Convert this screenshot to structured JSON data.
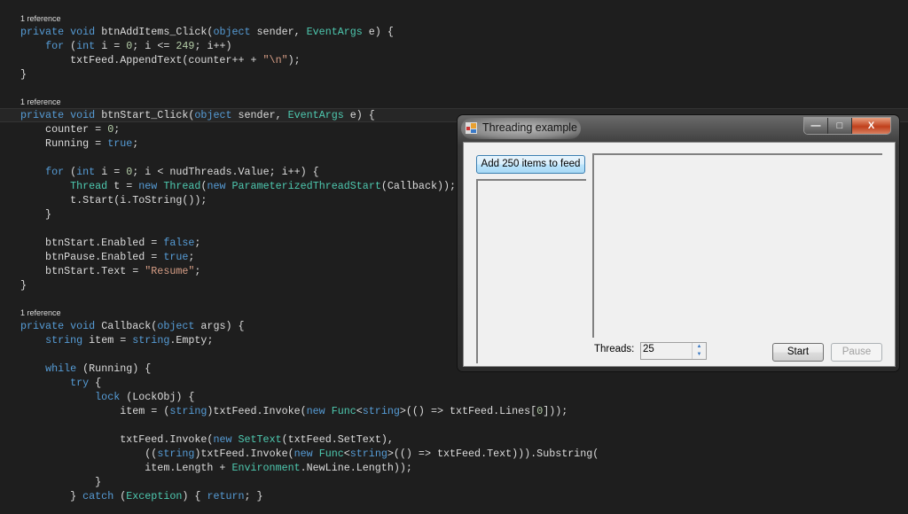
{
  "editor": {
    "lines": [
      {
        "kind": "ref",
        "tokens": [
          [
            "pl",
            "1 reference"
          ]
        ]
      },
      {
        "kind": "code",
        "tokens": [
          [
            "kw",
            "private void "
          ],
          [
            "pl",
            "btnAddItems_Click("
          ],
          [
            "kw",
            "object"
          ],
          [
            "pl",
            " sender, "
          ],
          [
            "ty",
            "EventArgs"
          ],
          [
            "pl",
            " e) {"
          ]
        ]
      },
      {
        "kind": "code",
        "tokens": [
          [
            "pl",
            "    "
          ],
          [
            "kw",
            "for"
          ],
          [
            "pl",
            " ("
          ],
          [
            "kw",
            "int"
          ],
          [
            "pl",
            " i = "
          ],
          [
            "nu",
            "0"
          ],
          [
            "pl",
            "; i <= "
          ],
          [
            "nu",
            "249"
          ],
          [
            "pl",
            "; i++)"
          ]
        ]
      },
      {
        "kind": "code",
        "tokens": [
          [
            "pl",
            "        txtFeed.AppendText(counter++ + "
          ],
          [
            "st",
            "\"\\n\""
          ],
          [
            "pl",
            ");"
          ]
        ]
      },
      {
        "kind": "code",
        "tokens": [
          [
            "pl",
            "}"
          ]
        ]
      },
      {
        "kind": "code",
        "tokens": []
      },
      {
        "kind": "ref",
        "tokens": [
          [
            "pl",
            "1 reference"
          ]
        ]
      },
      {
        "kind": "cur",
        "tokens": [
          [
            "kw",
            "private void "
          ],
          [
            "pl",
            "btnStart_Click("
          ],
          [
            "kw",
            "object"
          ],
          [
            "pl",
            " sender, "
          ],
          [
            "ty",
            "EventArgs"
          ],
          [
            "pl",
            " e) {"
          ]
        ]
      },
      {
        "kind": "code",
        "tokens": [
          [
            "pl",
            "    counter = "
          ],
          [
            "nu",
            "0"
          ],
          [
            "pl",
            ";"
          ]
        ]
      },
      {
        "kind": "code",
        "tokens": [
          [
            "pl",
            "    Running = "
          ],
          [
            "kw",
            "true"
          ],
          [
            "pl",
            ";"
          ]
        ]
      },
      {
        "kind": "code",
        "tokens": []
      },
      {
        "kind": "code",
        "tokens": [
          [
            "pl",
            "    "
          ],
          [
            "kw",
            "for"
          ],
          [
            "pl",
            " ("
          ],
          [
            "kw",
            "int"
          ],
          [
            "pl",
            " i = "
          ],
          [
            "nu",
            "0"
          ],
          [
            "pl",
            "; i < nudThreads.Value; i++) {"
          ]
        ]
      },
      {
        "kind": "code",
        "tokens": [
          [
            "pl",
            "        "
          ],
          [
            "ty",
            "Thread"
          ],
          [
            "pl",
            " t = "
          ],
          [
            "kw",
            "new "
          ],
          [
            "ty",
            "Thread"
          ],
          [
            "pl",
            "("
          ],
          [
            "kw",
            "new "
          ],
          [
            "ty",
            "ParameterizedThreadStart"
          ],
          [
            "pl",
            "(Callback));"
          ]
        ]
      },
      {
        "kind": "code",
        "tokens": [
          [
            "pl",
            "        t.Start(i.ToString());"
          ]
        ]
      },
      {
        "kind": "code",
        "tokens": [
          [
            "pl",
            "    }"
          ]
        ]
      },
      {
        "kind": "code",
        "tokens": []
      },
      {
        "kind": "code",
        "tokens": [
          [
            "pl",
            "    btnStart.Enabled = "
          ],
          [
            "kw",
            "false"
          ],
          [
            "pl",
            ";"
          ]
        ]
      },
      {
        "kind": "code",
        "tokens": [
          [
            "pl",
            "    btnPause.Enabled = "
          ],
          [
            "kw",
            "true"
          ],
          [
            "pl",
            ";"
          ]
        ]
      },
      {
        "kind": "code",
        "tokens": [
          [
            "pl",
            "    btnStart.Text = "
          ],
          [
            "st",
            "\"Resume\""
          ],
          [
            "pl",
            ";"
          ]
        ]
      },
      {
        "kind": "code",
        "tokens": [
          [
            "pl",
            "}"
          ]
        ]
      },
      {
        "kind": "code",
        "tokens": []
      },
      {
        "kind": "ref",
        "tokens": [
          [
            "pl",
            "1 reference"
          ]
        ]
      },
      {
        "kind": "code",
        "tokens": [
          [
            "kw",
            "private void "
          ],
          [
            "pl",
            "Callback("
          ],
          [
            "kw",
            "object"
          ],
          [
            "pl",
            " args) {"
          ]
        ]
      },
      {
        "kind": "code",
        "tokens": [
          [
            "pl",
            "    "
          ],
          [
            "kw",
            "string"
          ],
          [
            "pl",
            " item = "
          ],
          [
            "kw",
            "string"
          ],
          [
            "pl",
            ".Empty;"
          ]
        ]
      },
      {
        "kind": "code",
        "tokens": []
      },
      {
        "kind": "code",
        "tokens": [
          [
            "pl",
            "    "
          ],
          [
            "kw",
            "while"
          ],
          [
            "pl",
            " (Running) {"
          ]
        ]
      },
      {
        "kind": "code",
        "tokens": [
          [
            "pl",
            "        "
          ],
          [
            "kw",
            "try"
          ],
          [
            "pl",
            " {"
          ]
        ]
      },
      {
        "kind": "code",
        "tokens": [
          [
            "pl",
            "            "
          ],
          [
            "kw",
            "lock"
          ],
          [
            "pl",
            " (LockObj) {"
          ]
        ]
      },
      {
        "kind": "code",
        "tokens": [
          [
            "pl",
            "                item = ("
          ],
          [
            "kw",
            "string"
          ],
          [
            "pl",
            ")txtFeed.Invoke("
          ],
          [
            "kw",
            "new "
          ],
          [
            "ty",
            "Func"
          ],
          [
            "pl",
            "<"
          ],
          [
            "kw",
            "string"
          ],
          [
            "pl",
            ">(() => txtFeed.Lines["
          ],
          [
            "nu",
            "0"
          ],
          [
            "pl",
            "]));"
          ]
        ]
      },
      {
        "kind": "code",
        "tokens": []
      },
      {
        "kind": "code",
        "tokens": [
          [
            "pl",
            "                txtFeed.Invoke("
          ],
          [
            "kw",
            "new "
          ],
          [
            "ty",
            "SetText"
          ],
          [
            "pl",
            "(txtFeed.SetText),"
          ]
        ]
      },
      {
        "kind": "code",
        "tokens": [
          [
            "pl",
            "                    (("
          ],
          [
            "kw",
            "string"
          ],
          [
            "pl",
            ")txtFeed.Invoke("
          ],
          [
            "kw",
            "new "
          ],
          [
            "ty",
            "Func"
          ],
          [
            "pl",
            "<"
          ],
          [
            "kw",
            "string"
          ],
          [
            "pl",
            ">(() => txtFeed.Text))).Substring("
          ]
        ]
      },
      {
        "kind": "code",
        "tokens": [
          [
            "pl",
            "                    item.Length + "
          ],
          [
            "ty",
            "Environment"
          ],
          [
            "pl",
            ".NewLine.Length));"
          ]
        ]
      },
      {
        "kind": "code",
        "tokens": [
          [
            "pl",
            "            }"
          ]
        ]
      },
      {
        "kind": "code",
        "tokens": [
          [
            "pl",
            "        } "
          ],
          [
            "kw",
            "catch"
          ],
          [
            "pl",
            " ("
          ],
          [
            "ty",
            "Exception"
          ],
          [
            "pl",
            ") { "
          ],
          [
            "kw",
            "return"
          ],
          [
            "pl",
            "; }"
          ]
        ]
      }
    ]
  },
  "window": {
    "title": "Threading example",
    "minimize": "—",
    "maximize": "□",
    "close": "X",
    "add_button": "Add 250 items to feed",
    "threads_label": "Threads:",
    "threads_value": "25",
    "spin_up": "▲",
    "spin_down": "▼",
    "start_button": "Start",
    "pause_button": "Pause"
  }
}
